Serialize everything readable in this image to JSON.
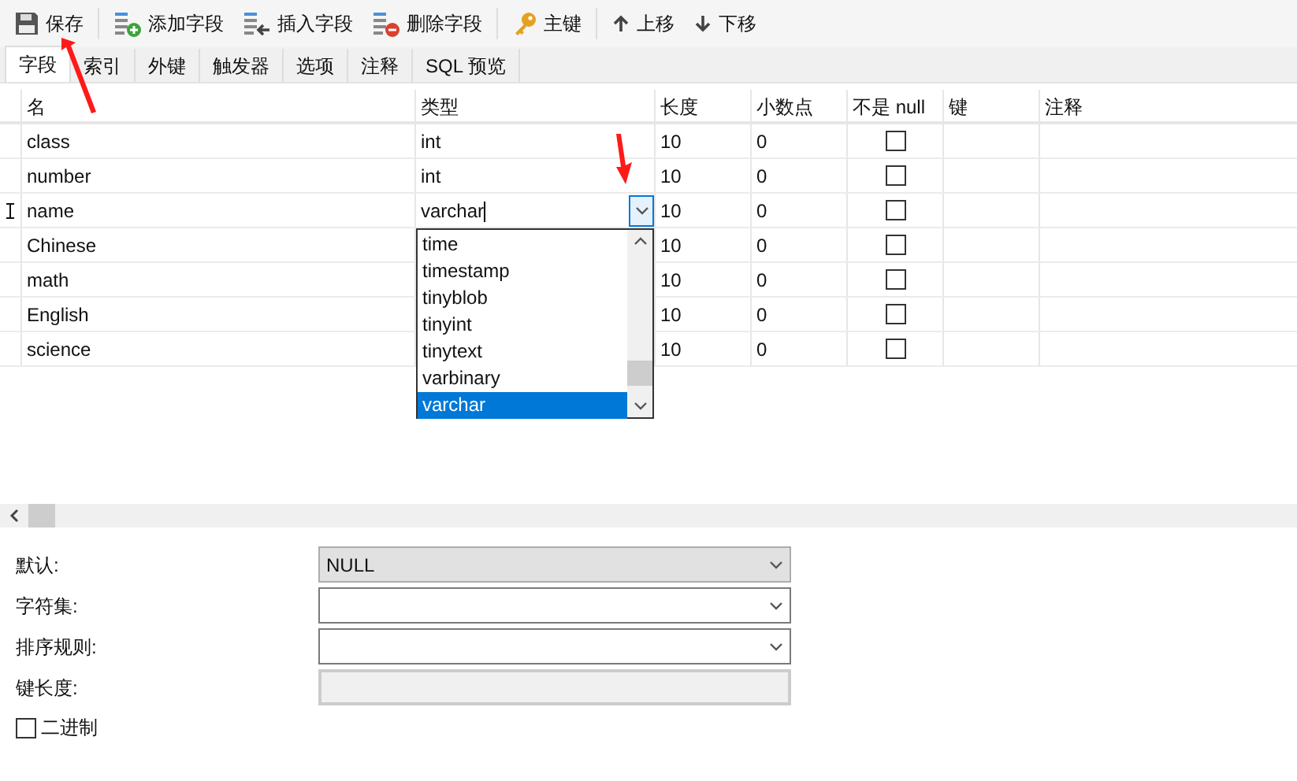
{
  "toolbar": [
    {
      "label": "保存",
      "kind": "save"
    },
    {
      "label": "添加字段",
      "kind": "add"
    },
    {
      "label": "插入字段",
      "kind": "insert"
    },
    {
      "label": "删除字段",
      "kind": "delete"
    },
    {
      "label": "主键",
      "kind": "key"
    },
    {
      "label": "上移",
      "kind": "up"
    },
    {
      "label": "下移",
      "kind": "down"
    }
  ],
  "tabs": [
    {
      "label": "字段",
      "selected": true
    },
    {
      "label": "索引",
      "selected": false
    },
    {
      "label": "外键",
      "selected": false
    },
    {
      "label": "触发器",
      "selected": false
    },
    {
      "label": "选项",
      "selected": false
    },
    {
      "label": "注释",
      "selected": false
    },
    {
      "label": "SQL 预览",
      "selected": false
    }
  ],
  "table": {
    "columns": [
      "名",
      "类型",
      "长度",
      "小数点",
      "不是 null",
      "键",
      "注释"
    ],
    "rows": [
      {
        "name": "class",
        "type": "int",
        "length": "10",
        "decimals": "0",
        "not_null": false,
        "editing": false
      },
      {
        "name": "number",
        "type": "int",
        "length": "10",
        "decimals": "0",
        "not_null": false,
        "editing": false
      },
      {
        "name": "name",
        "type": "varchar",
        "length": "10",
        "decimals": "0",
        "not_null": false,
        "editing": true
      },
      {
        "name": "Chinese",
        "length": "10",
        "decimals": "0",
        "not_null": false,
        "editing": false
      },
      {
        "name": "math",
        "length": "10",
        "decimals": "0",
        "not_null": false,
        "editing": false
      },
      {
        "name": "English",
        "length": "10",
        "decimals": "0",
        "not_null": false,
        "editing": false
      },
      {
        "name": "science",
        "length": "10",
        "decimals": "0",
        "not_null": false,
        "editing": false
      }
    ],
    "type_dropdown": {
      "expanded": true,
      "options": [
        {
          "label": "time",
          "selected": false
        },
        {
          "label": "timestamp",
          "selected": false
        },
        {
          "label": "tinyblob",
          "selected": false
        },
        {
          "label": "tinyint",
          "selected": false
        },
        {
          "label": "tinytext",
          "selected": false
        },
        {
          "label": "varbinary",
          "selected": false
        },
        {
          "label": "varchar",
          "selected": true
        }
      ]
    }
  },
  "properties": [
    {
      "label": "默认:",
      "value": "NULL",
      "disabled": false,
      "kind": "combo",
      "shaded": true
    },
    {
      "label": "字符集:",
      "kind": "combo",
      "disabled": false,
      "shaded": false
    },
    {
      "label": "排序规则:",
      "kind": "combo",
      "disabled": false,
      "shaded": false
    },
    {
      "label": "键长度:",
      "kind": "text",
      "disabled": true,
      "shaded": false
    }
  ],
  "binary": {
    "label": "二进制",
    "checked": false
  }
}
